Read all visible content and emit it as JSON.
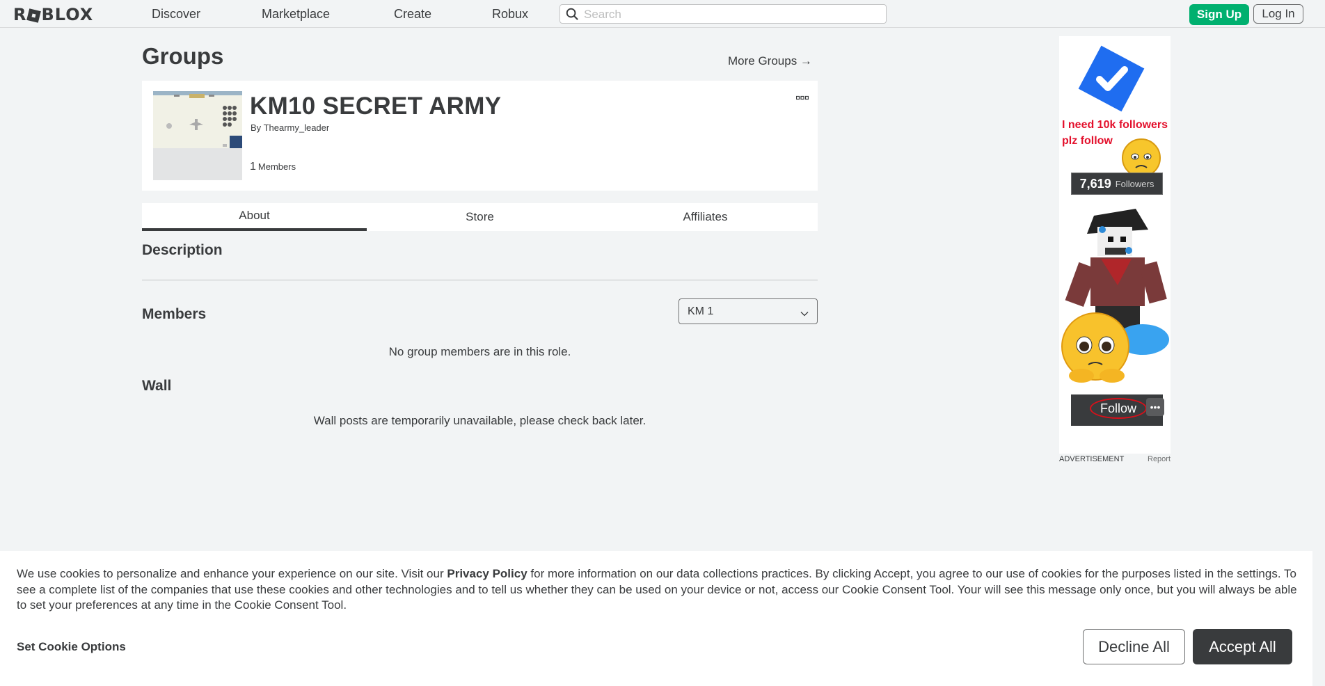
{
  "nav": {
    "logo": "ROBLOX",
    "links": [
      "Discover",
      "Marketplace",
      "Create",
      "Robux"
    ],
    "search_placeholder": "Search",
    "signup": "Sign Up",
    "login": "Log In"
  },
  "page": {
    "title": "Groups",
    "more_groups": "More Groups →"
  },
  "group": {
    "name": "KM10 SECRET ARMY",
    "by_label": "By",
    "owner": "Thearmy_leader",
    "member_count": "1",
    "member_label": "Members"
  },
  "tabs": [
    "About",
    "Store",
    "Affiliates"
  ],
  "sections": {
    "description": "Description",
    "members": "Members",
    "role_selected": "KM 1",
    "members_empty": "No group members are in this role.",
    "wall": "Wall",
    "wall_message": "Wall posts are temporarily unavailable, please check back later."
  },
  "ad": {
    "line1": "I need 10k followers",
    "line2": "plz follow",
    "followers_count": "7,619",
    "followers_label": "Followers",
    "follow_button": "Follow",
    "more": "•••",
    "label": "ADVERTISEMENT",
    "report": "Report"
  },
  "cookie": {
    "text_before": "We use cookies to personalize and enhance your experience on our site. Visit our ",
    "privacy_link": "Privacy Policy",
    "text_after": " for more information on our data collections practices. By clicking Accept, you agree to our use of cookies for the purposes listed in the settings. To see a complete list of the companies that use these cookies and other technologies and to tell us whether they can be used on your device or not, access our Cookie Consent Tool. Your will see this message only once, but you will always be able to set your preferences at any time in the Cookie Consent Tool.",
    "set_options": "Set Cookie Options",
    "decline": "Decline All",
    "accept": "Accept All"
  },
  "colors": {
    "accent_green": "#00b06f",
    "background": "#f2f4f5",
    "text": "#393b3d",
    "ad_red": "#e3102c"
  }
}
